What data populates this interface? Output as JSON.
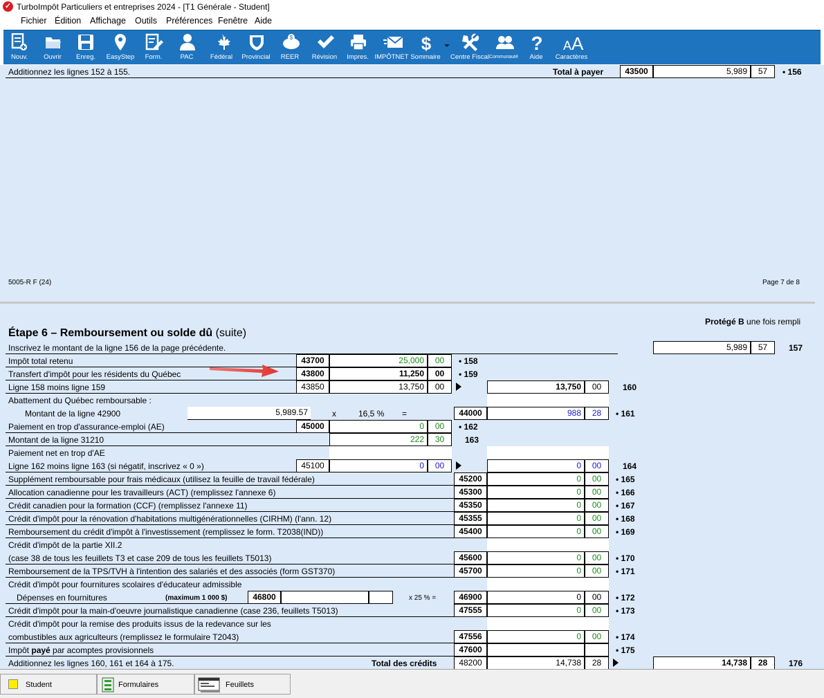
{
  "window": {
    "title": "TurboImpôt Particuliers et entreprises 2024 - [T1 Générale - Student]"
  },
  "menu": [
    "Fichier",
    "Édition",
    "Affichage",
    "Outils",
    "Préférences",
    "Fenêtre",
    "Aide"
  ],
  "toolbar": [
    {
      "label": "Nouv.",
      "icon": "new-form-icon"
    },
    {
      "label": "Ouvrir",
      "icon": "folder-open-icon"
    },
    {
      "label": "Enreg.",
      "icon": "save-disk-icon"
    },
    {
      "label": "EasyStep",
      "icon": "map-pin-icon"
    },
    {
      "label": "Form.",
      "icon": "form-pencil-icon"
    },
    {
      "label": "PAC",
      "icon": "user-icon"
    },
    {
      "label": "Fédéral",
      "icon": "maple-leaf-icon"
    },
    {
      "label": "Provincial",
      "icon": "shield-icon"
    },
    {
      "label": "REER",
      "icon": "piggy-bank-icon"
    },
    {
      "label": "Révision",
      "icon": "checkmark-icon"
    },
    {
      "label": "Impres.",
      "icon": "printer-icon"
    },
    {
      "label": "IMPÔTNET",
      "icon": "envelope-icon"
    },
    {
      "label": "Sommaire",
      "icon": "dollar-icon"
    },
    {
      "label": "Centre Fiscal",
      "icon": "tools-icon"
    },
    {
      "label": "Communauté",
      "icon": "community-icon"
    },
    {
      "label": "Aide",
      "icon": "question-icon"
    },
    {
      "label": "Caractères",
      "icon": "font-size-icon"
    }
  ],
  "page7": {
    "line156_text": "Additionnez les lignes 152 à 155.",
    "total_label": "Total à payer",
    "code": "43500",
    "amount": "5,989",
    "cents": "57",
    "line": "• 156",
    "form_id": "5005-R F (24)",
    "page": "Page 7 de 8"
  },
  "page8": {
    "protected_bold": "Protégé B",
    "protected_rest": " une fois rempli",
    "step_bold": "Étape 6 – Remboursement ou solde dû",
    "step_rest": " (suite)",
    "rows": {
      "r157": {
        "label": "Inscrivez le montant de la ligne 156 de la page précédente.",
        "amount": "5,989",
        "cents": "57",
        "line": "157"
      },
      "r158": {
        "label": "Impôt total retenu",
        "code": "43700",
        "amount": "25,000",
        "cents": "00",
        "line": "• 158"
      },
      "r159": {
        "label": "Transfert d'impôt pour les résidents du Québec",
        "code": "43800",
        "amount": "11,250",
        "cents": "00",
        "line": "• 159"
      },
      "r160": {
        "label": "Ligne 158 moins ligne 159",
        "code": "43850",
        "amount": "13,750",
        "cents": "00",
        "amount2": "13,750",
        "cents2": "00",
        "line": "160"
      },
      "r161a": {
        "label": "Abattement du Québec remboursable :"
      },
      "r161": {
        "label": "Montant de la ligne 42900",
        "input": "5,989.57",
        "x": "x",
        "pct": "16,5 %",
        "eq": "=",
        "code": "44000",
        "amount": "988",
        "cents": "28",
        "line": "• 161"
      },
      "r162": {
        "label": "Paiement en trop d'assurance-emploi (AE)",
        "code": "45000",
        "amount": "0",
        "cents": "00",
        "line": "• 162"
      },
      "r163": {
        "label": "Montant de la ligne 31210",
        "amount": "222",
        "cents": "30",
        "line": "163"
      },
      "r164a": {
        "label": "Paiement net en trop d'AE"
      },
      "r164": {
        "label": "Ligne 162 moins ligne 163 (si négatif, inscrivez « 0 »)",
        "code": "45100",
        "amount": "0",
        "cents": "00",
        "amount2": "0",
        "cents2": "00",
        "line": "164"
      },
      "r165": {
        "label": "Supplément remboursable pour frais médicaux (utilisez la feuille de travail fédérale)",
        "code": "45200",
        "amount": "0",
        "cents": "00",
        "line": "• 165"
      },
      "r166": {
        "label": "Allocation canadienne pour les travailleurs (ACT) (remplissez l'annexe 6)",
        "code": "45300",
        "amount": "0",
        "cents": "00",
        "line": "• 166"
      },
      "r167": {
        "label": "Crédit canadien pour la formation (CCF) (remplissez l'annexe 11)",
        "code": "45350",
        "amount": "0",
        "cents": "00",
        "line": "• 167"
      },
      "r168": {
        "label": "Crédit d'impôt pour la rénovation d'habitations multigénérationnelles (CIRHM) (l'ann. 12)",
        "code": "45355",
        "amount": "0",
        "cents": "00",
        "line": "• 168"
      },
      "r169": {
        "label": "Remboursement du crédit d'impôt à l'investissement (remplissez le form. T2038(IND))",
        "code": "45400",
        "amount": "0",
        "cents": "00",
        "line": "• 169"
      },
      "r170a": {
        "label": "Crédit d'impôt de la partie XII.2"
      },
      "r170": {
        "label": "(case 38 de tous les feuillets T3 et case 209 de tous les feuillets T5013)",
        "code": "45600",
        "amount": "0",
        "cents": "00",
        "line": "• 170"
      },
      "r171": {
        "label": "Remboursement de la TPS/TVH à l'intention des salariés et des associés (form GST370)",
        "code": "45700",
        "amount": "0",
        "cents": "00",
        "line": "• 171"
      },
      "r172a": {
        "label": "Crédit d'impôt pour fournitures scolaires d'éducateur admissible"
      },
      "r172": {
        "label": "Dépenses en fournitures",
        "max": "(maximum 1 000 $)",
        "code_in": "46800",
        "pct": "x 25 % =",
        "code": "46900",
        "amount": "0",
        "cents": "00",
        "line": "• 172"
      },
      "r173": {
        "label": "Crédit d'impôt pour la main-d'oeuvre journalistique canadienne (case 236, feuillets T5013)",
        "code": "47555",
        "amount": "0",
        "cents": "00",
        "line": "• 173"
      },
      "r174a": {
        "label": "Crédit d'impôt pour la remise des produits issus de la redevance sur les"
      },
      "r174": {
        "label": "combustibles aux agriculteurs (remplissez le formulaire T2043)",
        "code": "47556",
        "amount": "0",
        "cents": "00",
        "line": "• 174"
      },
      "r175": {
        "label_pre": "Impôt ",
        "label_bold": "payé",
        "label_post": " par acomptes provisionnels",
        "code": "47600",
        "line": "• 175"
      },
      "r176": {
        "label": "Additionnez les lignes 160, 161 et 164 à 175.",
        "total_label": "Total des crédits",
        "code": "48200",
        "amount": "14,738",
        "cents": "28",
        "amount2": "14,738",
        "cents2": "28",
        "line": "176"
      }
    }
  },
  "bottom_tabs": [
    {
      "label": "Student",
      "icon": "yellow-square-icon"
    },
    {
      "label": "Formulaires",
      "icon": "forms-icon"
    },
    {
      "label": "Feuillets",
      "icon": "slips-icon"
    }
  ],
  "colors": {
    "toolbar": "#1e74bf",
    "form_bg": "#dce9f8",
    "green_value": "#1a8a1a",
    "blue_value": "#1a1ad0",
    "arrow": "#e3342f"
  }
}
